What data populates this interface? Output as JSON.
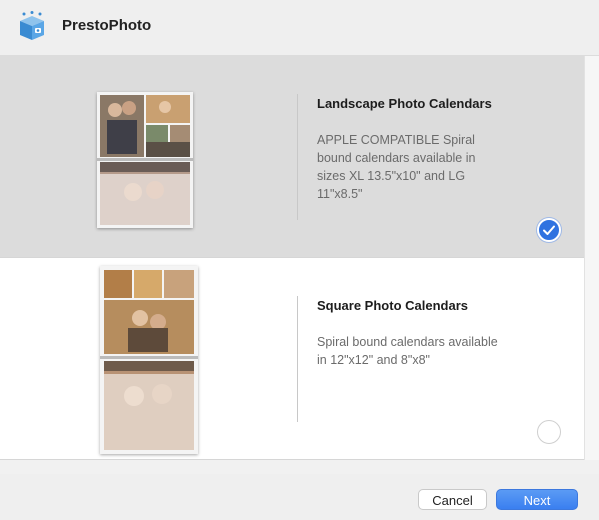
{
  "app": {
    "title": "PrestoPhoto",
    "icon": "presto-cube-icon"
  },
  "options": [
    {
      "title": "Landscape Photo Calendars",
      "description": "APPLE COMPATIBLE Spiral bound calendars available in sizes XL 13.5\"x10\" and LG 11\"x8.5\"",
      "selected": true
    },
    {
      "title": "Square Photo Calendars",
      "description": "Spiral bound calendars available in 12\"x12\" and 8\"x8\"",
      "selected": false
    }
  ],
  "buttons": {
    "cancel": "Cancel",
    "next": "Next"
  },
  "colors": {
    "accent": "#2f72e0",
    "selected_bg": "#dcdcdc"
  }
}
